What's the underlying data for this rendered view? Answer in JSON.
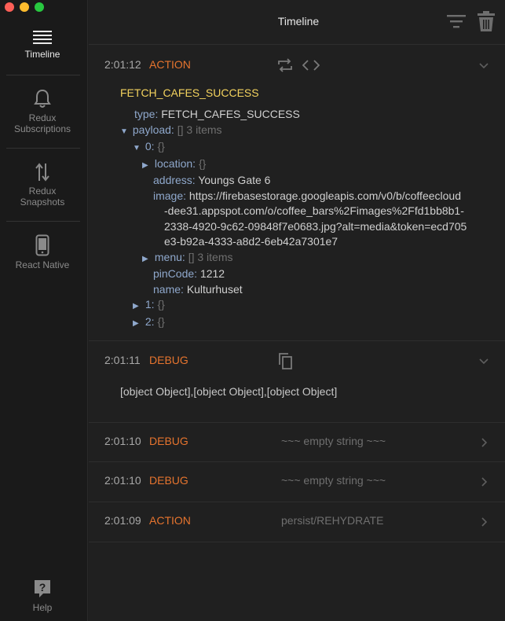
{
  "app": {
    "title": "Timeline"
  },
  "sidebar": {
    "items": [
      {
        "label": "Timeline",
        "active": true
      },
      {
        "label": "Redux\nSubscriptions",
        "line1": "Redux",
        "line2": "Subscriptions"
      },
      {
        "label": "Redux Snapshots",
        "line1": "Redux",
        "line2": "Snapshots"
      },
      {
        "label": "React Native"
      },
      {
        "label": "Help"
      }
    ]
  },
  "entries": [
    {
      "time": "2:01:12",
      "kind": "ACTION",
      "action_name": "FETCH_CAFES_SUCCESS",
      "tree": {
        "type_key": "type:",
        "type_val": "FETCH_CAFES_SUCCESS",
        "payload_key": "payload:",
        "payload_meta": "[]  3 items",
        "item0_key": "0:",
        "item0_meta": "{}",
        "location_key": "location:",
        "location_meta": "{}",
        "address_key": "address:",
        "address_val": "Youngs Gate 6",
        "image_key": "image:",
        "image_val_1": "https://firebasestorage.googleapis.com/v0/b/coffeecloud",
        "image_val_2": "-dee31.appspot.com/o/coffee_bars%2Fimages%2Ffd1bb8b1-",
        "image_val_3": "2338-4920-9c62-09848f7e0683.jpg?alt=media&token=ecd705",
        "image_val_4": "e3-b92a-4333-a8d2-6eb42a7301e7",
        "menu_key": "menu:",
        "menu_meta": "[]  3 items",
        "pincode_key": "pinCode:",
        "pincode_val": "1212",
        "name_key": "name:",
        "name_val": "Kulturhuset",
        "item1_key": "1:",
        "item1_meta": "{}",
        "item2_key": "2:",
        "item2_meta": "{}"
      }
    },
    {
      "time": "2:01:11",
      "kind": "DEBUG",
      "body": "[object Object],[object Object],[object Object]"
    },
    {
      "time": "2:01:10",
      "kind": "DEBUG",
      "preview": "~~~ empty string ~~~"
    },
    {
      "time": "2:01:10",
      "kind": "DEBUG",
      "preview": "~~~ empty string ~~~"
    },
    {
      "time": "2:01:09",
      "kind": "ACTION",
      "preview": "persist/REHYDRATE"
    }
  ],
  "colors": {
    "action": "#e6742e",
    "debug": "#e6742e",
    "action_name": "#f4d35e",
    "key": "#8fa8cc",
    "value": "#d0d0d0",
    "muted": "#6f6f6f"
  },
  "icons": {
    "timeline": "list-icon",
    "subscriptions": "bell-icon",
    "snapshots": "swap-vertical-icon",
    "react_native": "phone-icon",
    "help": "help-icon",
    "filter": "filter-icon",
    "trash": "trash-icon",
    "repeat": "repeat-icon",
    "code": "code-icon",
    "copy": "copy-icon",
    "chevron_down": "chevron-down-icon",
    "chevron_right": "chevron-right-icon"
  }
}
